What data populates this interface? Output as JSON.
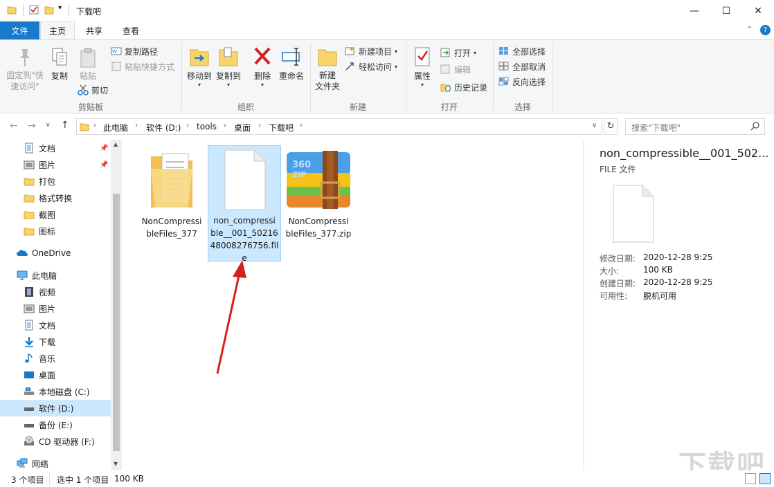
{
  "window": {
    "title": "下载吧",
    "minimize": "—",
    "maximize": "☐",
    "close": "✕"
  },
  "tabs": [
    "文件",
    "主页",
    "共享",
    "查看"
  ],
  "ribbon": {
    "clipboard": {
      "label": "剪贴板",
      "pin": "固定到\"快速访问\"",
      "copy": "复制",
      "paste": "粘贴",
      "copy_path": "复制路径",
      "paste_shortcut": "粘贴快捷方式",
      "cut": "剪切"
    },
    "organize": {
      "label": "组织",
      "move_to": "移动到",
      "copy_to": "复制到",
      "delete": "删除",
      "rename": "重命名"
    },
    "new": {
      "label": "新建",
      "new_folder": "新建\n文件夹",
      "new_item": "新建项目",
      "easy_access": "轻松访问"
    },
    "open": {
      "label": "打开",
      "properties": "属性",
      "open": "打开",
      "edit": "编辑",
      "history": "历史记录"
    },
    "select": {
      "label": "选择",
      "select_all": "全部选择",
      "select_none": "全部取消",
      "invert": "反向选择"
    }
  },
  "address": {
    "crumbs": [
      "此电脑",
      "软件 (D:)",
      "tools",
      "桌面",
      "下载吧"
    ],
    "search_placeholder": "搜索\"下载吧\""
  },
  "nav": {
    "quick": [
      "文档",
      "图片",
      "打包",
      "格式转换",
      "截图",
      "图标"
    ],
    "onedrive": "OneDrive",
    "thispc": "此电脑",
    "pc_items": [
      "视频",
      "图片",
      "文档",
      "下载",
      "音乐",
      "桌面",
      "本地磁盘 (C:)",
      "软件 (D:)",
      "备份 (E:)",
      "CD 驱动器 (F:)"
    ],
    "network": "网络"
  },
  "files": [
    {
      "name": "NonCompressibleFiles_377",
      "lines": [
        "NonCompressi",
        "bleFiles_377"
      ]
    },
    {
      "name": "non_compressible__001_5021648008276756.file",
      "lines": [
        "non_compressi",
        "ble__001_50216",
        "48008276756.fil",
        "e"
      ]
    },
    {
      "name": "NonCompressibleFiles_377.zip",
      "lines": [
        "NonCompressi",
        "bleFiles_377.zip"
      ]
    }
  ],
  "details": {
    "title": "non_compressible__001_502...",
    "type": "FILE 文件",
    "rows": [
      {
        "k": "修改日期:",
        "v": "2020-12-28 9:25"
      },
      {
        "k": "大小:",
        "v": "100 KB"
      },
      {
        "k": "创建日期:",
        "v": "2020-12-28 9:25"
      },
      {
        "k": "可用性:",
        "v": "脱机可用"
      }
    ]
  },
  "status": {
    "count": "3 个项目",
    "selected": "选中 1 个项目",
    "size": "100 KB"
  },
  "watermark": "下载吧",
  "colors": {
    "accent": "#1979ca",
    "selection": "#cce8ff",
    "arrow": "#d42020"
  }
}
